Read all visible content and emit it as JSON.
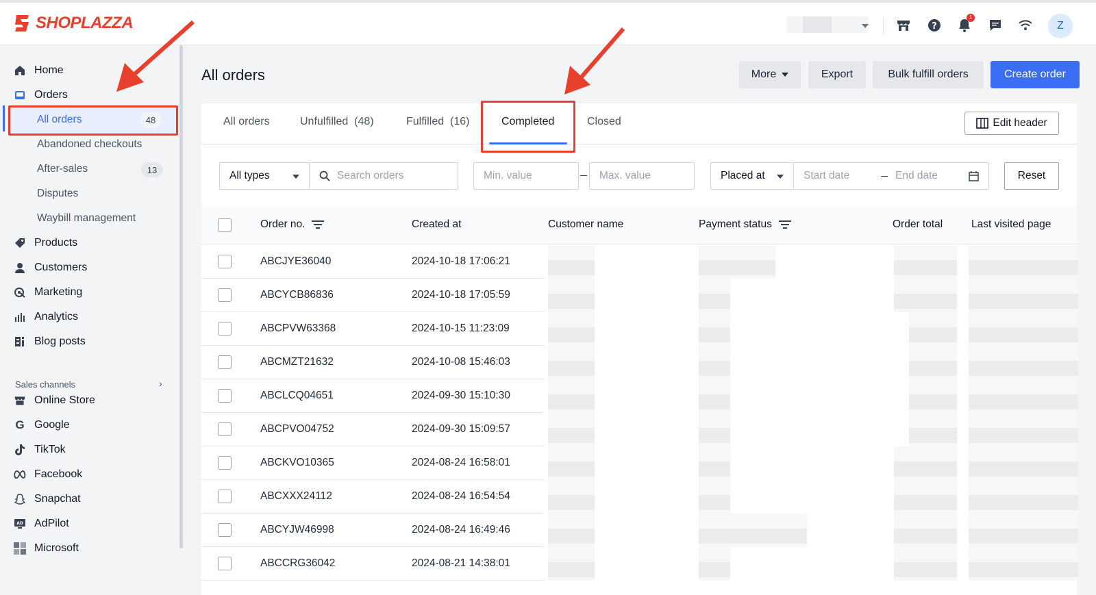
{
  "brand": {
    "name": "SHOPLAZZA",
    "color": "#e8402d"
  },
  "topbar": {
    "icons": [
      "store-icon",
      "help-icon",
      "bell-icon",
      "chat-icon",
      "wifi-icon"
    ],
    "notification_count": "1",
    "avatar_initial": "Z"
  },
  "sidebar": {
    "items": [
      {
        "label": "Home",
        "icon": "home-icon"
      },
      {
        "label": "Orders",
        "icon": "orders-icon"
      }
    ],
    "order_subitems": [
      {
        "label": "All orders",
        "count": "48",
        "active": true
      },
      {
        "label": "Abandoned checkouts"
      },
      {
        "label": "After-sales",
        "count": "13"
      },
      {
        "label": "Disputes"
      },
      {
        "label": "Waybill management"
      }
    ],
    "more_items": [
      {
        "label": "Products",
        "icon": "tag-icon"
      },
      {
        "label": "Customers",
        "icon": "person-icon"
      },
      {
        "label": "Marketing",
        "icon": "marketing-icon"
      },
      {
        "label": "Analytics",
        "icon": "analytics-icon"
      },
      {
        "label": "Blog posts",
        "icon": "blog-icon"
      }
    ],
    "sales_channels_label": "Sales channels",
    "channels": [
      {
        "label": "Online Store",
        "icon": "store-icon"
      },
      {
        "label": "Google",
        "icon": "google-icon"
      },
      {
        "label": "TikTok",
        "icon": "tiktok-icon"
      },
      {
        "label": "Facebook",
        "icon": "meta-icon"
      },
      {
        "label": "Snapchat",
        "icon": "snapchat-icon"
      },
      {
        "label": "AdPilot",
        "icon": "adpilot-icon"
      },
      {
        "label": "Microsoft",
        "icon": "microsoft-icon"
      }
    ]
  },
  "header": {
    "title": "All orders",
    "buttons": {
      "more": "More",
      "export": "Export",
      "bulk_fulfill": "Bulk fulfill orders",
      "create": "Create order"
    }
  },
  "tabs": [
    {
      "label": "All orders"
    },
    {
      "label": "Unfulfilled  (48)"
    },
    {
      "label": "Fulfilled  (16)"
    },
    {
      "label": "Completed",
      "active": true
    },
    {
      "label": "Closed"
    }
  ],
  "edit_header_label": "Edit header",
  "filters": {
    "type_value": "All types",
    "search_placeholder": "Search orders",
    "min_placeholder": "Min. value",
    "max_placeholder": "Max. value",
    "date_field": "Placed at",
    "start_placeholder": "Start date",
    "end_placeholder": "End date",
    "reset": "Reset"
  },
  "table": {
    "columns": [
      "Order no.",
      "Created at",
      "Customer name",
      "Payment status",
      "Order total",
      "Last visited page"
    ],
    "rows": [
      {
        "order_no": "ABCJYE36040",
        "created_at": "2024-10-18 17:06:21"
      },
      {
        "order_no": "ABCYCB86836",
        "created_at": "2024-10-18 17:05:59"
      },
      {
        "order_no": "ABCPVW63368",
        "created_at": "2024-10-15 11:23:09"
      },
      {
        "order_no": "ABCMZT21632",
        "created_at": "2024-10-08 15:46:03"
      },
      {
        "order_no": "ABCLCQ04651",
        "created_at": "2024-09-30 15:10:30"
      },
      {
        "order_no": "ABCPVO04752",
        "created_at": "2024-09-30 15:09:57"
      },
      {
        "order_no": "ABCKVO10365",
        "created_at": "2024-08-24 16:58:01"
      },
      {
        "order_no": "ABCXXX24112",
        "created_at": "2024-08-24 16:54:54"
      },
      {
        "order_no": "ABCYJW46998",
        "created_at": "2024-08-24 16:49:46"
      },
      {
        "order_no": "ABCCRG36042",
        "created_at": "2024-08-21 14:38:01"
      }
    ]
  },
  "colors": {
    "accent": "#3b6ef5",
    "highlight": "#e8402d"
  }
}
